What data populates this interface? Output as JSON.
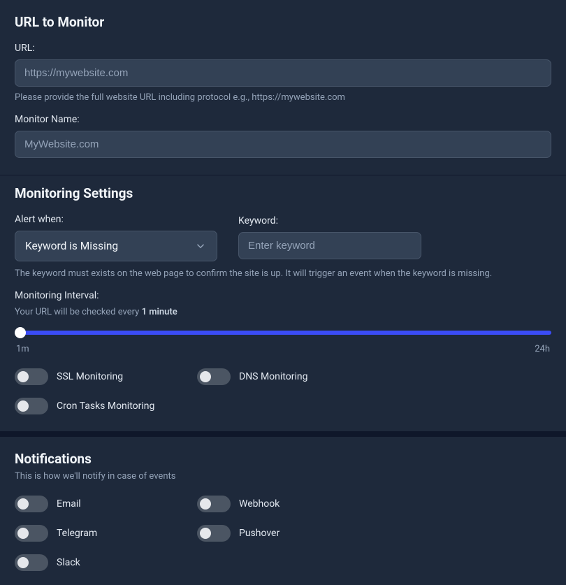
{
  "section1": {
    "title": "URL to Monitor",
    "url_label": "URL:",
    "url_placeholder": "https://mywebsite.com",
    "url_hint": "Please provide the full website URL including protocol e.g., https://mywebsite.com",
    "name_label": "Monitor Name:",
    "name_placeholder": "MyWebsite.com"
  },
  "section2": {
    "title": "Monitoring Settings",
    "alert_label": "Alert when:",
    "alert_selected": "Keyword is Missing",
    "keyword_label": "Keyword:",
    "keyword_placeholder": "Enter keyword",
    "keyword_desc": "The keyword must exists on the web page to confirm the site is up. It will trigger an event when the keyword is missing.",
    "interval_label": "Monitoring Interval:",
    "interval_prefix": "Your URL will be checked every ",
    "interval_value": "1 minute",
    "slider_min": "1m",
    "slider_max": "24h",
    "toggles": {
      "ssl": "SSL Monitoring",
      "dns": "DNS Monitoring",
      "cron": "Cron Tasks Monitoring"
    }
  },
  "section3": {
    "title": "Notifications",
    "sub": "This is how we'll notify in case of events",
    "toggles": {
      "email": "Email",
      "webhook": "Webhook",
      "telegram": "Telegram",
      "pushover": "Pushover",
      "slack": "Slack"
    }
  }
}
